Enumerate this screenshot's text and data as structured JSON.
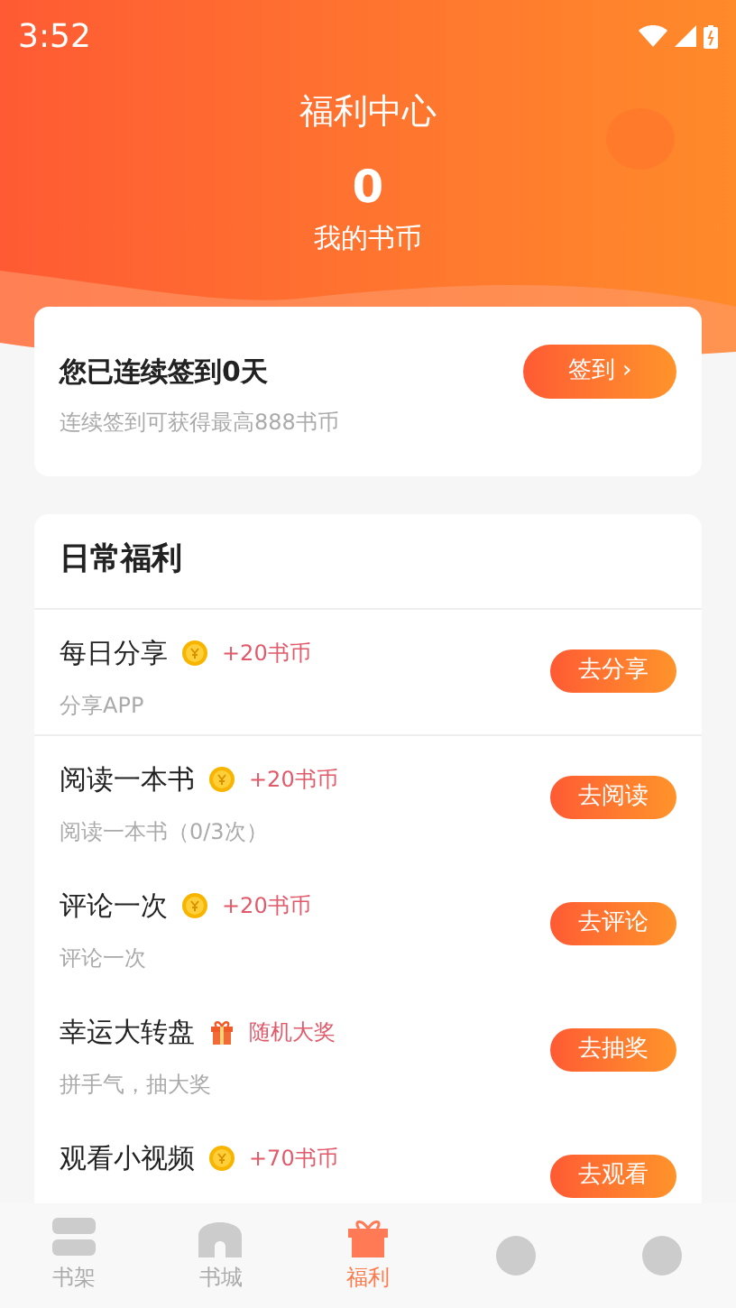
{
  "status_bar": {
    "time": "3:52"
  },
  "header": {
    "title": "福利中心",
    "coins": "0",
    "coins_label": "我的书币"
  },
  "checkin": {
    "title": "您已连续签到**0**天",
    "subtitle": "连续签到可获得最高888书币",
    "button": "签到 ›"
  },
  "daily": {
    "title": "日常福利",
    "tasks": [
      {
        "title": "每日分享",
        "kind": "coin",
        "reward": "+20书币",
        "subtitle": "分享APP",
        "button": "去分享"
      },
      {
        "title": "阅读一本书",
        "kind": "coin",
        "reward": "+20书币",
        "subtitle": "阅读一本书（0/3次）",
        "button": "去阅读"
      },
      {
        "title": "评论一次",
        "kind": "coin",
        "reward": "+20书币",
        "subtitle": "评论一次",
        "button": "去评论"
      },
      {
        "title": "幸运大转盘",
        "kind": "gift",
        "reward": "随机大奖",
        "subtitle": "拼手气，抽大奖",
        "button": "去抽奖"
      },
      {
        "title": "观看小视频",
        "kind": "coin",
        "reward": "+70书币",
        "button": "去观看"
      }
    ]
  },
  "tab_bar": [
    {
      "label": "书架",
      "selected": false
    },
    {
      "label": "书城",
      "selected": false
    },
    {
      "label": "福利",
      "selected": true
    },
    {
      "selected": false
    },
    {
      "selected": false
    }
  ]
}
